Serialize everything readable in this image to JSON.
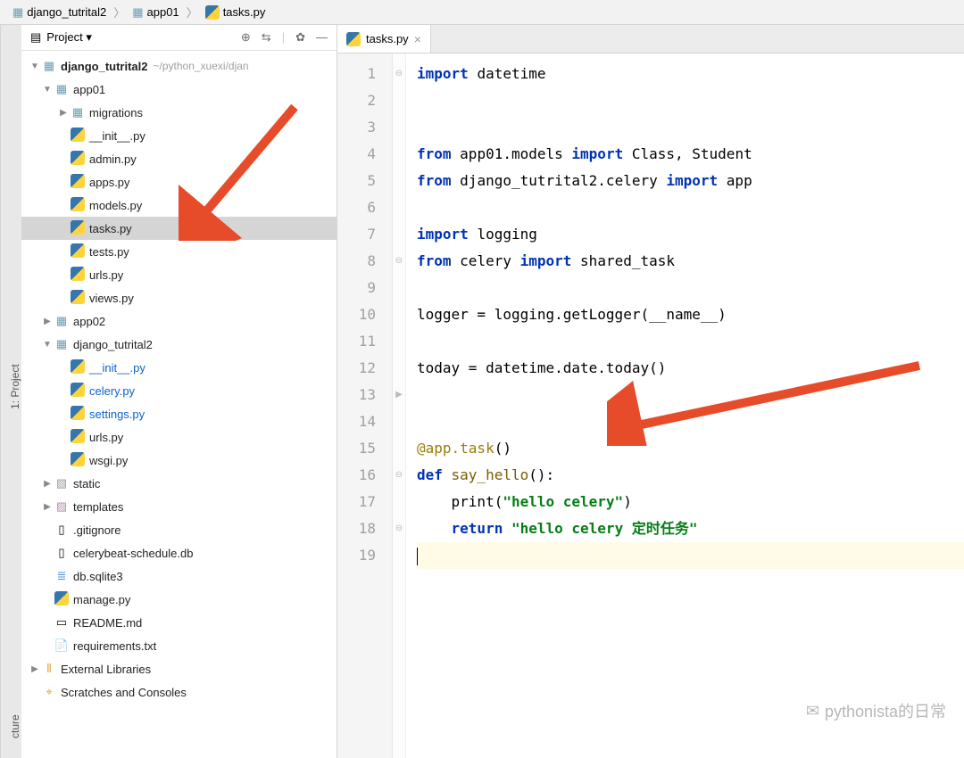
{
  "breadcrumb": [
    {
      "label": "django_tutrital2",
      "icon": "folder"
    },
    {
      "label": "app01",
      "icon": "folder"
    },
    {
      "label": "tasks.py",
      "icon": "py"
    }
  ],
  "side_tabs": {
    "left_top": "1: Project",
    "left_bottom": "cture"
  },
  "project_panel": {
    "title": "Project",
    "header_icons": [
      "target-icon",
      "collapse-icon",
      "divider",
      "gear-icon",
      "minimize-icon"
    ]
  },
  "tree": [
    {
      "depth": 0,
      "arrow": "▼",
      "icon": "folder",
      "label": "django_tutrital2",
      "bold": true,
      "note": "~/python_xuexi/djan"
    },
    {
      "depth": 1,
      "arrow": "▼",
      "icon": "folder",
      "label": "app01"
    },
    {
      "depth": 2,
      "arrow": "▶",
      "icon": "folder",
      "label": "migrations"
    },
    {
      "depth": 2,
      "arrow": "",
      "icon": "py",
      "label": "__init__.py"
    },
    {
      "depth": 2,
      "arrow": "",
      "icon": "py",
      "label": "admin.py"
    },
    {
      "depth": 2,
      "arrow": "",
      "icon": "py",
      "label": "apps.py"
    },
    {
      "depth": 2,
      "arrow": "",
      "icon": "py",
      "label": "models.py"
    },
    {
      "depth": 2,
      "arrow": "",
      "icon": "py",
      "label": "tasks.py",
      "selected": true
    },
    {
      "depth": 2,
      "arrow": "",
      "icon": "py",
      "label": "tests.py"
    },
    {
      "depth": 2,
      "arrow": "",
      "icon": "py",
      "label": "urls.py"
    },
    {
      "depth": 2,
      "arrow": "",
      "icon": "py",
      "label": "views.py"
    },
    {
      "depth": 1,
      "arrow": "▶",
      "icon": "folder",
      "label": "app02"
    },
    {
      "depth": 1,
      "arrow": "▼",
      "icon": "folder",
      "label": "django_tutrital2"
    },
    {
      "depth": 2,
      "arrow": "",
      "icon": "py",
      "label": "__init__.py",
      "blue": true
    },
    {
      "depth": 2,
      "arrow": "",
      "icon": "py",
      "label": "celery.py",
      "blue": true
    },
    {
      "depth": 2,
      "arrow": "",
      "icon": "py",
      "label": "settings.py",
      "blue": true
    },
    {
      "depth": 2,
      "arrow": "",
      "icon": "py",
      "label": "urls.py"
    },
    {
      "depth": 2,
      "arrow": "",
      "icon": "py",
      "label": "wsgi.py"
    },
    {
      "depth": 1,
      "arrow": "▶",
      "icon": "folder-gray",
      "label": "static"
    },
    {
      "depth": 1,
      "arrow": "▶",
      "icon": "folder-purple",
      "label": "templates"
    },
    {
      "depth": 1,
      "arrow": "",
      "icon": "file",
      "label": ".gitignore"
    },
    {
      "depth": 1,
      "arrow": "",
      "icon": "file",
      "label": "celerybeat-schedule.db"
    },
    {
      "depth": 1,
      "arrow": "",
      "icon": "db",
      "label": "db.sqlite3"
    },
    {
      "depth": 1,
      "arrow": "",
      "icon": "py",
      "label": "manage.py"
    },
    {
      "depth": 1,
      "arrow": "",
      "icon": "md",
      "label": "README.md"
    },
    {
      "depth": 1,
      "arrow": "",
      "icon": "txt",
      "label": "requirements.txt"
    },
    {
      "depth": 0,
      "arrow": "▶",
      "icon": "lib",
      "label": "External Libraries"
    },
    {
      "depth": 0,
      "arrow": "",
      "icon": "scratch",
      "label": "Scratches and Consoles"
    }
  ],
  "editor": {
    "tab": {
      "label": "tasks.py"
    },
    "lines": [
      {
        "n": 1,
        "seg": [
          {
            "t": "import ",
            "c": "kw"
          },
          {
            "t": "datetime"
          }
        ]
      },
      {
        "n": 2,
        "seg": []
      },
      {
        "n": 3,
        "seg": []
      },
      {
        "n": 4,
        "seg": [
          {
            "t": "from ",
            "c": "kw"
          },
          {
            "t": "app01.models "
          },
          {
            "t": "import ",
            "c": "kw"
          },
          {
            "t": "Class, Student"
          }
        ]
      },
      {
        "n": 5,
        "seg": [
          {
            "t": "from ",
            "c": "kw"
          },
          {
            "t": "django_tutrital2.celery "
          },
          {
            "t": "import ",
            "c": "kw"
          },
          {
            "t": "app"
          }
        ]
      },
      {
        "n": 6,
        "seg": []
      },
      {
        "n": 7,
        "seg": [
          {
            "t": "import ",
            "c": "kw"
          },
          {
            "t": "logging"
          }
        ]
      },
      {
        "n": 8,
        "seg": [
          {
            "t": "from ",
            "c": "kw"
          },
          {
            "t": "celery "
          },
          {
            "t": "import ",
            "c": "kw"
          },
          {
            "t": "shared_task"
          }
        ]
      },
      {
        "n": 9,
        "seg": []
      },
      {
        "n": 10,
        "seg": [
          {
            "t": "logger = logging.getLogger(__name__)"
          }
        ]
      },
      {
        "n": 11,
        "seg": []
      },
      {
        "n": 12,
        "seg": [
          {
            "t": "today = datetime.date.today()"
          }
        ]
      },
      {
        "n": 13,
        "seg": []
      },
      {
        "n": 14,
        "seg": []
      },
      {
        "n": 15,
        "seg": [
          {
            "t": "@app.task",
            "c": "dec"
          },
          {
            "t": "()"
          }
        ]
      },
      {
        "n": 16,
        "seg": [
          {
            "t": "def ",
            "c": "kw"
          },
          {
            "t": "say_hello",
            "c": "fn"
          },
          {
            "t": "():"
          }
        ]
      },
      {
        "n": 17,
        "seg": [
          {
            "t": "    print("
          },
          {
            "t": "\"hello celery\"",
            "c": "str"
          },
          {
            "t": ")"
          }
        ]
      },
      {
        "n": 18,
        "seg": [
          {
            "t": "    "
          },
          {
            "t": "return ",
            "c": "kw"
          },
          {
            "t": "\"hello celery 定时任务\"",
            "c": "str"
          }
        ]
      },
      {
        "n": 19,
        "seg": [],
        "hl": true,
        "cursor": true
      }
    ],
    "fold_markers": {
      "1": "⊖",
      "4": "",
      "8": "⊖",
      "13": "▶",
      "16": "⊖",
      "18": "⊖"
    }
  },
  "watermark": "pythonista的日常"
}
